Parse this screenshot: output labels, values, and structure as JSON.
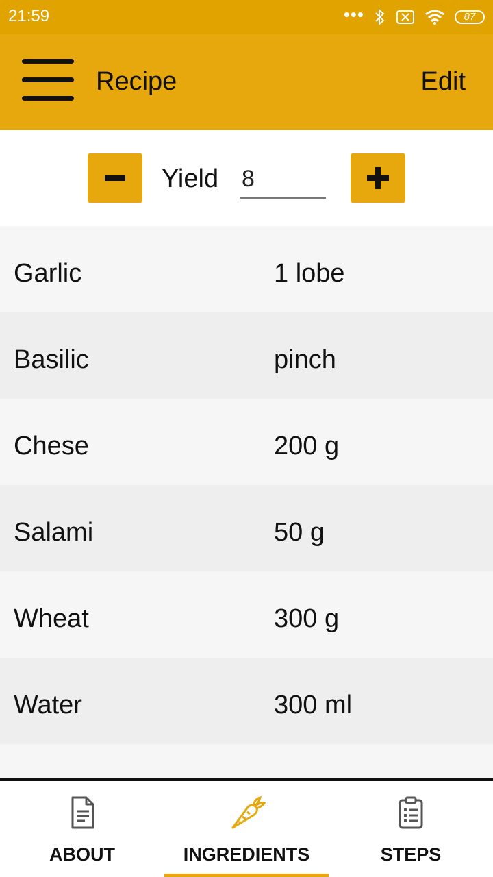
{
  "status_bar": {
    "time": "21:59",
    "dots": "•••",
    "battery": "87"
  },
  "app_bar": {
    "title": "Recipe",
    "edit_label": "Edit"
  },
  "yield": {
    "label": "Yield",
    "value": "8"
  },
  "ingredients": [
    {
      "name": "Garlic",
      "quantity": "1 lobe"
    },
    {
      "name": "Basilic",
      "quantity": "pinch"
    },
    {
      "name": "Chese",
      "quantity": "200 g"
    },
    {
      "name": "Salami",
      "quantity": "50 g"
    },
    {
      "name": "Wheat",
      "quantity": "300 g"
    },
    {
      "name": "Water",
      "quantity": "300 ml"
    }
  ],
  "bottom_nav": {
    "items": [
      {
        "label": "ABOUT",
        "icon": "document-icon"
      },
      {
        "label": "INGREDIENTS",
        "icon": "carrot-icon"
      },
      {
        "label": "STEPS",
        "icon": "clipboard-list-icon"
      }
    ],
    "active": "INGREDIENTS"
  },
  "colors": {
    "status_bar": "#e0a300",
    "accent": "#e6a80c"
  }
}
